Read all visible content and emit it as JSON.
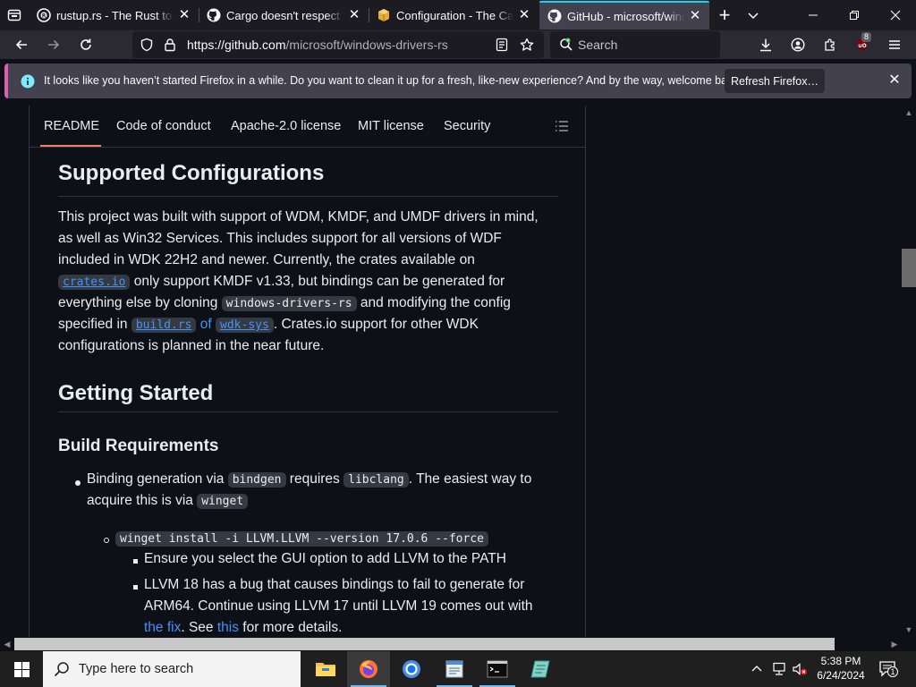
{
  "browser": {
    "tabs": [
      {
        "title": "rustup.rs - The Rust toolchain installer",
        "favicon": "rust-logo-icon",
        "active": false
      },
      {
        "title": "Cargo doesn't respect git config",
        "favicon": "github-icon",
        "active": false
      },
      {
        "title": "Configuration - The Cargo Book",
        "favicon": "cargo-icon",
        "active": false
      },
      {
        "title": "GitHub - microsoft/windows-drivers-rs",
        "favicon": "github-icon",
        "active": true
      }
    ],
    "url_host": "https://github.com",
    "url_path": "/microsoft/windows-drivers-rs",
    "search_placeholder": "Search",
    "extension_badge": "8",
    "accent": "#00ddff"
  },
  "notification": {
    "message": "It looks like you haven’t started Firefox in a while. Do you want to clean it up for a fresh, like-new experience? And by the way, welcome back!",
    "button": "Refresh Firefox…",
    "accent": "#e15bb0"
  },
  "readme_tabs": [
    "README",
    "Code of conduct",
    "Apache-2.0 license",
    "MIT license",
    "Security"
  ],
  "content": {
    "h_supported": "Supported Configurations",
    "p1": {
      "l1": "This project was built with support of WDM, KMDF, and UMDF drivers in mind,",
      "l2": "as well as Win32 Services. This includes support for all versions of WDF",
      "l3": "included in WDK 22H2 and newer. Currently, the crates available on",
      "l4_code": "crates.io",
      "l4_rest": " only support KMDF v1.33, but bindings can be generated for",
      "l5_a": "everything else by cloning ",
      "l5_code": "windows-drivers-rs",
      "l5_b": " and modifying the config",
      "l6_a": "specified in ",
      "l6_code1": "build.rs",
      "l6_of": " of ",
      "l6_code2": "wdk-sys",
      "l6_b": ". Crates.io support for other WDK",
      "l7": "configurations is planned in the near future."
    },
    "h_getting_started": "Getting Started",
    "h_build_req": "Build Requirements",
    "li1": {
      "a": "Binding generation via ",
      "code1": "bindgen",
      "b": " requires ",
      "code2": "libclang",
      "c": ". The easiest way to",
      "d": "acquire this is via ",
      "code3": "winget"
    },
    "li2_code": "winget install -i LLVM.LLVM --version 17.0.6 --force",
    "li3": "Ensure you select the GUI option to add LLVM to the PATH",
    "li4": {
      "l1": "LLVM 18 has a bug that causes bindings to fail to generate for",
      "l2": "ARM64. Continue using LLVM 17 until LLVM 19 comes out with",
      "link1": "the fix",
      "mid": ". See ",
      "link2": "this",
      "end": " for more details."
    }
  },
  "taskbar": {
    "search_placeholder": "Type here to search",
    "apps": [
      "file-explorer-icon",
      "firefox-icon",
      "chrome-icon",
      "notepad-icon",
      "terminal-icon",
      "app-icon"
    ],
    "time": "5:38 PM",
    "date": "6/24/2024",
    "notification_count": "1"
  }
}
